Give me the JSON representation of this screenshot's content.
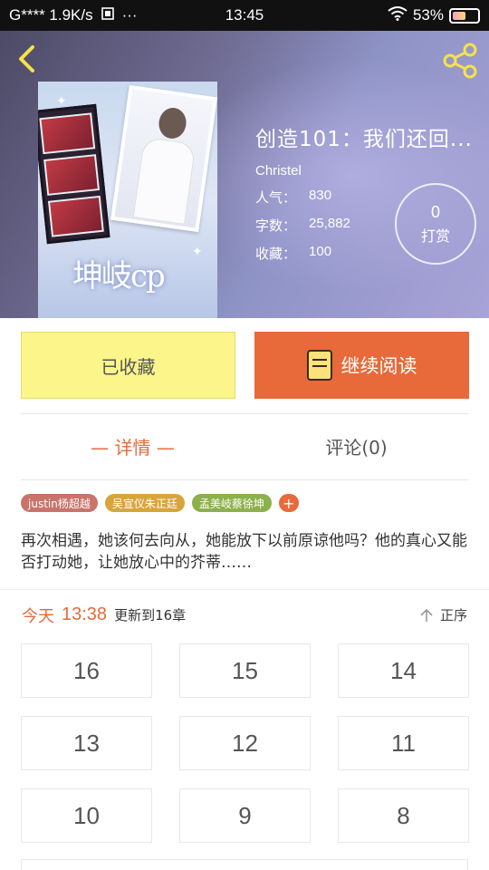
{
  "status_bar": {
    "carrier": "G**** 1.9K/s",
    "time": "13:45",
    "battery_percent": "53%",
    "battery_level": 0.53
  },
  "book": {
    "title": "创造101：我们还回...",
    "author": "Christel",
    "popularity_label": "人气：",
    "popularity": "830",
    "words_label": "字数：",
    "words": "25,882",
    "favorites_label": "收藏：",
    "favorites": "100",
    "cover_text": "坤岐cp"
  },
  "tip": {
    "count": "0",
    "label": "打赏"
  },
  "actions": {
    "collected_label": "已收藏",
    "continue_label": "继续阅读"
  },
  "tabs": [
    {
      "label": "— 详情 —",
      "active": true
    },
    {
      "label": "评论(0)",
      "active": false
    }
  ],
  "tags": [
    {
      "label": "justin杨超越",
      "color": "#c9736a"
    },
    {
      "label": "吴宣仪朱正廷",
      "color": "#d8a53c"
    },
    {
      "label": "孟美岐蔡徐坤",
      "color": "#8cb04a"
    },
    {
      "label": "+",
      "color": "#e8693a"
    }
  ],
  "summary": "再次相遇，她该何去向从，她能放下以前原谅他吗？他的真心又能否打动她，让她放心中的芥蒂……",
  "update": {
    "day": "今天",
    "time": "13:38",
    "text": "更新到16章",
    "sort_label": "正序"
  },
  "chapters": [
    "16",
    "15",
    "14",
    "13",
    "12",
    "11",
    "10",
    "9",
    "8"
  ],
  "colors": {
    "accent": "#e8693a",
    "collected_bg": "#fbf58a"
  }
}
